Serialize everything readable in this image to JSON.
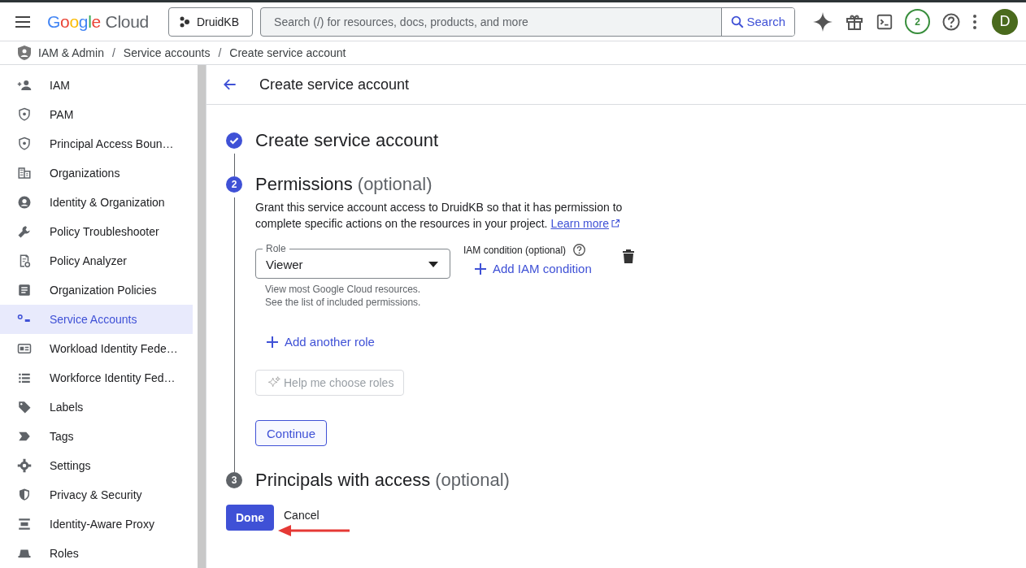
{
  "topbar": {
    "logo": "Google",
    "logo_suffix": "Cloud",
    "project": "DruidKB",
    "search": {
      "placeholder": "Search (/) for resources, docs, products, and more",
      "button": "Search"
    },
    "notifications": "2",
    "avatar": "D"
  },
  "breadcrumb": {
    "items": [
      "IAM & Admin",
      "Service accounts",
      "Create service account"
    ],
    "separator": "/"
  },
  "sidebar": {
    "items": [
      {
        "label": "IAM",
        "selected": false
      },
      {
        "label": "PAM",
        "selected": false
      },
      {
        "label": "Principal Access Boun…",
        "selected": false
      },
      {
        "label": "Organizations",
        "selected": false
      },
      {
        "label": "Identity & Organization",
        "selected": false
      },
      {
        "label": "Policy Troubleshooter",
        "selected": false
      },
      {
        "label": "Policy Analyzer",
        "selected": false
      },
      {
        "label": "Organization Policies",
        "selected": false
      },
      {
        "label": "Service Accounts",
        "selected": true
      },
      {
        "label": "Workload Identity Fede…",
        "selected": false
      },
      {
        "label": "Workforce Identity Fed…",
        "selected": false
      },
      {
        "label": "Labels",
        "selected": false
      },
      {
        "label": "Tags",
        "selected": false
      },
      {
        "label": "Settings",
        "selected": false
      },
      {
        "label": "Privacy & Security",
        "selected": false
      },
      {
        "label": "Identity-Aware Proxy",
        "selected": false
      },
      {
        "label": "Roles",
        "selected": false
      }
    ]
  },
  "page": {
    "title": "Create service account",
    "steps": [
      {
        "done": true,
        "selected": false,
        "title": "Create service account"
      },
      {
        "done": false,
        "selected": true,
        "number": "2",
        "title": "Permissions",
        "suffix": "(optional)"
      },
      {
        "done": false,
        "selected": false,
        "number": "3",
        "title": "Principals with access",
        "suffix": "(optional)"
      }
    ],
    "description": "Grant this service account access to DruidKB so that it has permission to complete specific actions on the resources in your project.",
    "learn_more": "Learn more",
    "role": {
      "label": "Role",
      "value": "Viewer",
      "hint": [
        "View most Google Cloud resources.",
        "See the list of included permissions."
      ]
    },
    "condition": {
      "label": "IAM condition (optional)",
      "add": "Add IAM condition"
    },
    "add_role": "Add another role",
    "help_button": {
      "label": "Help me choose roles",
      "disabled": true
    },
    "continue": "Continue",
    "done": "Done",
    "cancel": "Cancel"
  }
}
